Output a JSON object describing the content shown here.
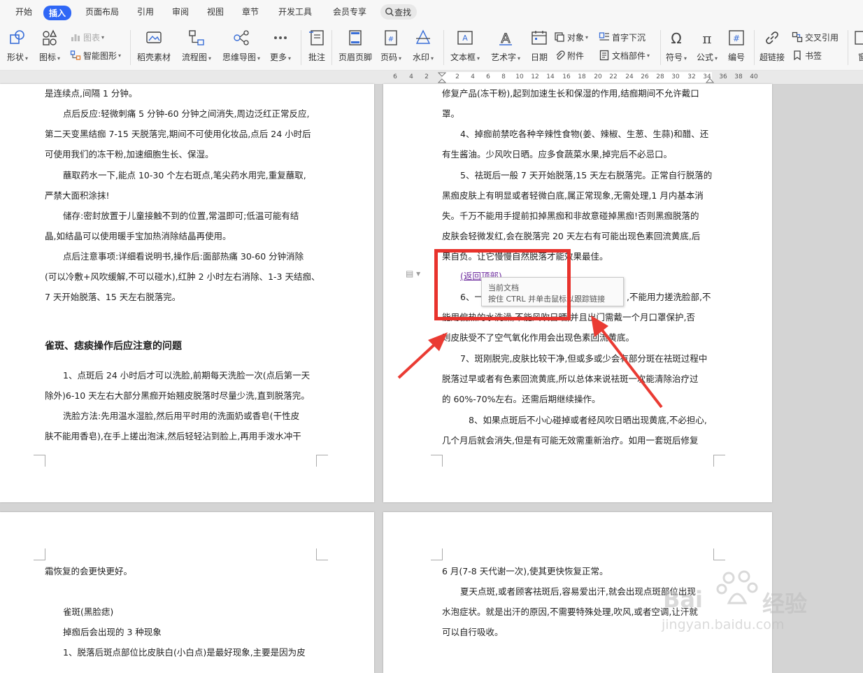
{
  "menu": {
    "items": [
      "开始",
      "插入",
      "页面布局",
      "引用",
      "审阅",
      "视图",
      "章节",
      "开发工具",
      "会员专享"
    ],
    "active": "插入",
    "search_label": "查找"
  },
  "ribbon": {
    "shape": "形状",
    "icon_lib": "图标",
    "chart": "图表",
    "smart_art": "智能图形",
    "docer": "稻壳素材",
    "flowchart": "流程图",
    "mindmap": "思维导图",
    "more": "更多",
    "comment": "批注",
    "header_footer": "页眉页脚",
    "page_number": "页码",
    "watermark": "水印",
    "textbox": "文本框",
    "wordart": "艺术字",
    "date": "日期",
    "object": "对象",
    "attachment": "附件",
    "drop_cap": "首字下沉",
    "doc_parts": "文档部件",
    "symbol": "符号",
    "formula": "公式",
    "numbering": "编号",
    "hyperlink": "超链接",
    "cross_ref": "交叉引用",
    "bookmark": "书签",
    "window": "窗"
  },
  "ruler": {
    "ticks": [
      "6",
      "4",
      "2",
      "2",
      "4",
      "6",
      "8",
      "10",
      "12",
      "14",
      "16",
      "18",
      "20",
      "22",
      "24",
      "26",
      "28",
      "30",
      "32",
      "34",
      "36",
      "38",
      "40"
    ]
  },
  "page_left_top": {
    "lines": [
      "是连续点,间隔 1 分钟。",
      "点后反应:轻微刺痛 5 分钟-60 分钟之间消失,周边泛红正常反应,",
      "第二天变黑结痂 7-15 天脱落完,期间不可使用化妆品,点后 24 小时后",
      "可使用我们的冻干粉,加速细胞生长、保湿。",
      "蘸取药水一下,能点 10-30 个左右斑点,笔尖药水用完,重复蘸取,",
      "严禁大面积涂抹!",
      "储存:密封放置于儿童接触不到的位置,常温即可;低温可能有结",
      "晶,如结晶可以使用暖手宝加热消除结晶再使用。",
      "点后注意事项:详细看说明书,操作后:面部热痛 30-60 分钟消除",
      "(可以冷敷+风吹缓解,不可以碰水),红肿 2 小时左右消除、1-3 天结痂、",
      "7 天开始脱落、15 天左右脱落完。"
    ],
    "heading": "雀斑、痣痰操作后应注意的问题",
    "lines2": [
      "1、点斑后 24 小时后才可以洗脸,前期每天洗脸一次(点后第一天",
      "除外)6-10 天左右大部分黑痂开始翘皮脱落时尽量少洗,直到脱落完。",
      "洗脸方法:先用温水湿脸,然后用平时用的洗面奶或香皂(干性皮",
      "肤不能用香皂),在手上搓出泡沫,然后轻轻沾到脸上,再用手泼水冲干"
    ]
  },
  "page_right_top": {
    "lines": [
      "修复产品(冻干粉),起到加速生长和保湿的作用,结痂期间不允许戴口",
      "罩。",
      "4、掉痂前禁吃各种辛辣性食物(姜、辣椒、生葱、生蒜)和醋、还",
      "有生酱油。少风吹日晒。应多食蔬菜水果,掉完后不必忌口。",
      "5、祛斑后一般 7 天开始脱落,15 天左右脱落完。正常自行脱落的",
      "黑痂皮肤上有明显或者轻微白底,属正常现象,无需处理,1 月内基本消",
      "失。千万不能用手提前扣掉黑痂和非故意碰掉黑痂!否则黑痂脱落的",
      "皮肤会轻微发红,会在脱落完 20 天左右有可能出现色素回流黄底,后",
      "果自负。让它慢慢自然脱落才能效果最佳。"
    ],
    "link_text": "(返回顶部)",
    "line6_start": "6、一",
    "line6_end": ",不能用力搓洗脸部,不",
    "lines2": [
      "能用偏热的水洗澡,不能风吹日晒,并且出门需戴一个月口罩保护,否",
      "则皮肤受不了空气氧化作用会出现色素回流黄底。",
      "7、斑刚脱完,皮肤比较干净,但或多或少会有部分斑在祛斑过程中",
      "脱落过早或者有色素回流黄底,所以总体来说祛斑一次能清除治疗过",
      "的 60%-70%左右。还需后期继续操作。",
      "8、如果点斑后不小心碰掉或者经风吹日晒出现黄底,不必担心,",
      "几个月后就会消失,但是有可能无效需重新治疗。如用一套斑后修复"
    ]
  },
  "tooltip": {
    "line1": "当前文档",
    "line2": "按住 CTRL 并单击鼠标以跟踪链接"
  },
  "page_left_bottom": {
    "lines": [
      "霜恢复的会更快更好。",
      "雀斑(黑脸痣)",
      "掉痂后会出现的 3 种现象",
      "1、脱落后斑点部位比皮肤白(小白点)是最好现象,主要是因为皮"
    ]
  },
  "page_right_bottom": {
    "lines": [
      "6 月(7-8 天代谢一次),使其更快恢复正常。",
      "夏天点斑,或者顾客祛斑后,容易爱出汗,就会出现点斑部位出现",
      "水泡症状。就是出汗的原因,不需要特殊处理,吹风,或者空调,让汗就",
      "可以自行吸收。"
    ]
  },
  "watermark": {
    "brand1": "Bai",
    "brand2": "经验",
    "url": "jingyan.baidu.com"
  },
  "colors": {
    "accent": "#2f67f6",
    "annotation_red": "#e8322c",
    "link": "#7030a0"
  }
}
